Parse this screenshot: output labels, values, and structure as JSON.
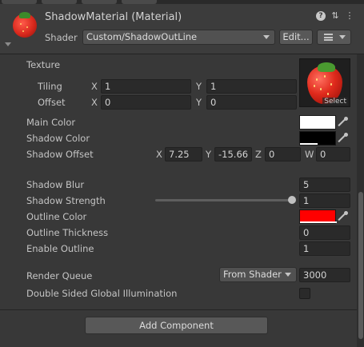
{
  "header": {
    "title": "ShadowMaterial (Material)",
    "shader_label": "Shader",
    "shader_value": "Custom/ShadowOutLine",
    "edit_label": "Edit...",
    "icons": [
      "help-icon",
      "preset-icon",
      "more-icon"
    ]
  },
  "texture": {
    "label": "Texture",
    "select_label": "Select",
    "tiling_label": "Tiling",
    "offset_label": "Offset",
    "tiling_x": "1",
    "tiling_y": "1",
    "offset_x": "0",
    "offset_y": "0"
  },
  "axes": {
    "x": "X",
    "y": "Y",
    "z": "Z",
    "w": "W"
  },
  "properties": {
    "main_color_label": "Main Color",
    "main_color": "#ffffff",
    "shadow_color_label": "Shadow Color",
    "shadow_color": "#000000",
    "shadow_offset_label": "Shadow Offset",
    "shadow_offset": {
      "x": "7.25",
      "y": "-15.66",
      "z": "0",
      "w": "0"
    },
    "shadow_blur_label": "Shadow Blur",
    "shadow_blur": "5",
    "shadow_strength_label": "Shadow Strength",
    "shadow_strength": "1",
    "shadow_strength_slider_fraction": 1.0,
    "outline_color_label": "Outline Color",
    "outline_color": "#ff0000",
    "outline_thickness_label": "Outline Thickness",
    "outline_thickness": "0",
    "enable_outline_label": "Enable Outline",
    "enable_outline": "1"
  },
  "render_queue": {
    "label": "Render Queue",
    "mode": "From Shader",
    "value": "3000"
  },
  "double_sided_gi": {
    "label": "Double Sided Global Illumination",
    "checked": false
  },
  "add_component_label": "Add Component"
}
